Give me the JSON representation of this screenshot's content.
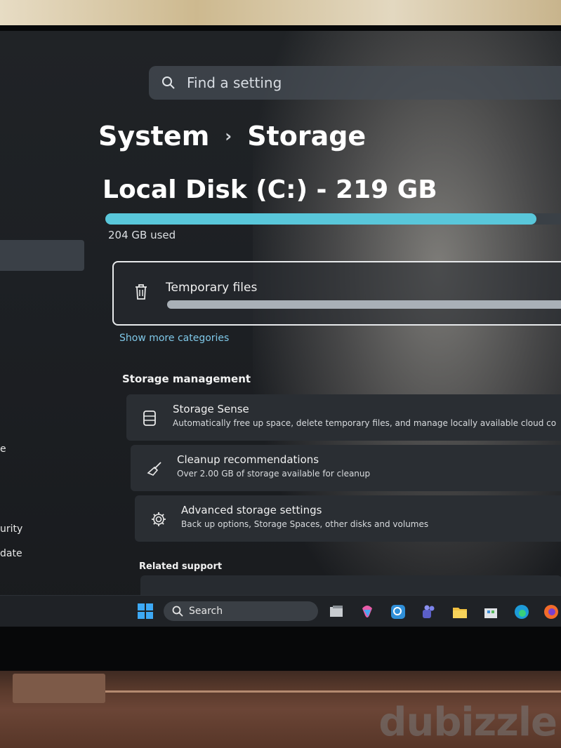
{
  "search": {
    "placeholder": "Find a setting"
  },
  "breadcrumb": {
    "parent": "System",
    "separator": "›",
    "current": "Storage"
  },
  "disk": {
    "title": "Local Disk (C:) - 219 GB",
    "used_text": "204 GB used",
    "used_fraction": 0.93
  },
  "categories": {
    "items": [
      {
        "label": "Temporary files",
        "used_fraction": 0.95
      }
    ],
    "show_more": "Show more categories"
  },
  "storage_management": {
    "heading": "Storage management",
    "items": [
      {
        "title": "Storage Sense",
        "description": "Automatically free up space, delete temporary files, and manage locally available cloud co",
        "icon": "storage-sense-icon"
      },
      {
        "title": "Cleanup recommendations",
        "description": "Over 2.00 GB of storage available for cleanup",
        "icon": "broom-icon"
      },
      {
        "title": "Advanced storage settings",
        "description": "Back up options, Storage Spaces, other disks and volumes",
        "icon": "gear-icon"
      }
    ]
  },
  "related_support": {
    "heading": "Related support"
  },
  "sidebar": {
    "partial_labels": [
      "e",
      "urity",
      "date"
    ]
  },
  "taskbar": {
    "search_label": "Search",
    "icons": [
      "windows-start-icon",
      "task-view-icon",
      "copilot-icon",
      "search-app-icon",
      "teams-icon",
      "file-explorer-icon",
      "store-icon",
      "edge-icon",
      "firefox-icon"
    ]
  },
  "watermark": "dubizzle",
  "colors": {
    "accent": "#59c7da",
    "link": "#7fc8e8"
  }
}
